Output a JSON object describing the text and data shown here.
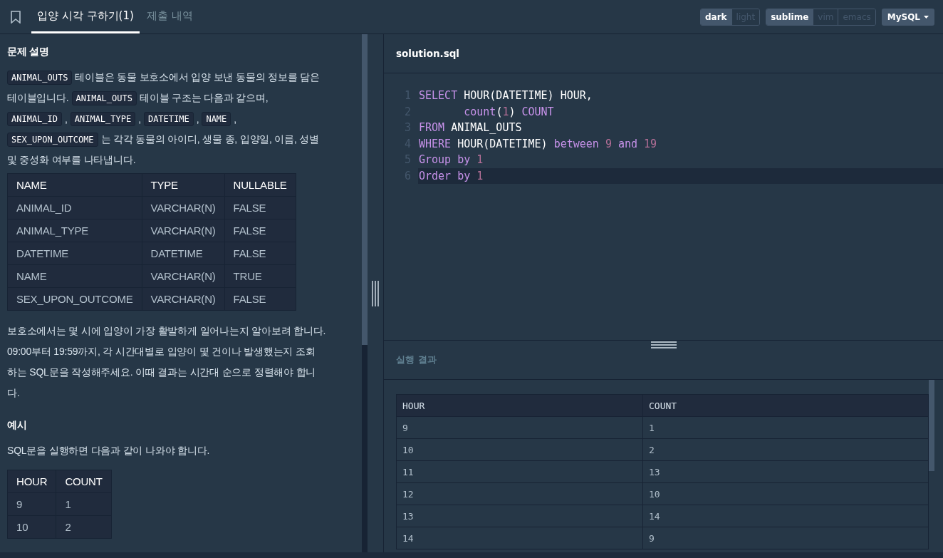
{
  "tabs": [
    {
      "label": "입양 시각 구하기(1)",
      "selected": true
    },
    {
      "label": "제출 내역",
      "selected": false
    }
  ],
  "theme_toggle": [
    {
      "label": "dark",
      "selected": true
    },
    {
      "label": "light",
      "selected": false
    }
  ],
  "keymap_toggle": [
    {
      "label": "sublime",
      "selected": true
    },
    {
      "label": "vim",
      "selected": false
    },
    {
      "label": "emacs",
      "selected": false
    }
  ],
  "language_dropdown": {
    "label": "MySQL"
  },
  "description": {
    "heading": "문제 설명",
    "intro": [
      [
        {
          "kind": "code",
          "text": "ANIMAL_OUTS"
        },
        {
          "kind": "text",
          "text": "테이블은 동물 보호소에서 입양 보낸 동물의 정보를 담은"
        }
      ],
      [
        {
          "kind": "text",
          "text": "테이블입니다."
        },
        {
          "kind": "code",
          "text": "ANIMAL_OUTS"
        },
        {
          "kind": "text",
          "text": "테이블 구조는 다음과 같으며,"
        }
      ],
      [
        {
          "kind": "code",
          "text": "ANIMAL_ID"
        },
        {
          "kind": "text",
          "text": ","
        },
        {
          "kind": "code",
          "text": "ANIMAL_TYPE"
        },
        {
          "kind": "text",
          "text": ","
        },
        {
          "kind": "code",
          "text": "DATETIME"
        },
        {
          "kind": "text",
          "text": ","
        },
        {
          "kind": "code",
          "text": "NAME"
        },
        {
          "kind": "text",
          "text": ","
        }
      ],
      [
        {
          "kind": "code",
          "text": "SEX_UPON_OUTCOME"
        },
        {
          "kind": "text",
          "text": "는 각각 동물의 아이디, 생물 종, 입양일, 이름, 성별"
        }
      ],
      [
        {
          "kind": "text",
          "text": "및 중성화 여부를 나타냅니다."
        }
      ]
    ],
    "schema_table": {
      "columns": [
        "NAME",
        "TYPE",
        "NULLABLE"
      ],
      "rows": [
        [
          "ANIMAL_ID",
          "VARCHAR(N)",
          "FALSE"
        ],
        [
          "ANIMAL_TYPE",
          "VARCHAR(N)",
          "FALSE"
        ],
        [
          "DATETIME",
          "DATETIME",
          "FALSE"
        ],
        [
          "NAME",
          "VARCHAR(N)",
          "TRUE"
        ],
        [
          "SEX_UPON_OUTCOME",
          "VARCHAR(N)",
          "FALSE"
        ]
      ]
    },
    "task": [
      "보호소에서는 몇 시에 입양이 가장 활발하게 일어나는지 알아보려 합니다.",
      "09:00부터 19:59까지, 각 시간대별로 입양이 몇 건이나 발생했는지 조회",
      "하는 SQL문을 작성해주세요. 이때 결과는 시간대 순으로 정렬해야 합니",
      "다."
    ],
    "example_heading": "예시",
    "example_text": "SQL문을 실행하면 다음과 같이 나와야 합니다.",
    "example_table": {
      "columns": [
        "HOUR",
        "COUNT"
      ],
      "rows": [
        [
          "9",
          "1"
        ],
        [
          "10",
          "2"
        ]
      ]
    }
  },
  "editor": {
    "filename": "solution.sql",
    "lines": [
      {
        "number": "1",
        "selected": false,
        "tokens": [
          {
            "kind": "keyword",
            "text": "SELECT"
          },
          {
            "kind": "plain",
            "text": " HOUR(DATETIME) HOUR,"
          }
        ]
      },
      {
        "number": "2",
        "selected": false,
        "tokens": [
          {
            "kind": "keyword",
            "text": "       count"
          },
          {
            "kind": "plain",
            "text": "("
          },
          {
            "kind": "number",
            "text": "1"
          },
          {
            "kind": "plain",
            "text": ") "
          },
          {
            "kind": "keyword",
            "text": "COUNT"
          }
        ]
      },
      {
        "number": "3",
        "selected": false,
        "tokens": [
          {
            "kind": "keyword",
            "text": "FROM"
          },
          {
            "kind": "plain",
            "text": " ANIMAL_OUTS"
          }
        ]
      },
      {
        "number": "4",
        "selected": false,
        "tokens": [
          {
            "kind": "keyword",
            "text": "WHERE"
          },
          {
            "kind": "plain",
            "text": " HOUR(DATETIME) "
          },
          {
            "kind": "keyword",
            "text": "between "
          },
          {
            "kind": "number",
            "text": "9 "
          },
          {
            "kind": "keyword",
            "text": "and "
          },
          {
            "kind": "number",
            "text": "19"
          }
        ]
      },
      {
        "number": "5",
        "selected": false,
        "tokens": [
          {
            "kind": "keyword",
            "text": "Group by "
          },
          {
            "kind": "number",
            "text": "1"
          }
        ]
      },
      {
        "number": "6",
        "selected": true,
        "tokens": [
          {
            "kind": "keyword",
            "text": "Order by "
          },
          {
            "kind": "number",
            "text": "1"
          }
        ]
      }
    ]
  },
  "results": {
    "heading": "실행 결과",
    "columns": [
      "HOUR",
      "COUNT"
    ],
    "rows": [
      [
        "9",
        "1"
      ],
      [
        "10",
        "2"
      ],
      [
        "11",
        "13"
      ],
      [
        "12",
        "10"
      ],
      [
        "13",
        "14"
      ],
      [
        "14",
        "9"
      ]
    ]
  }
}
